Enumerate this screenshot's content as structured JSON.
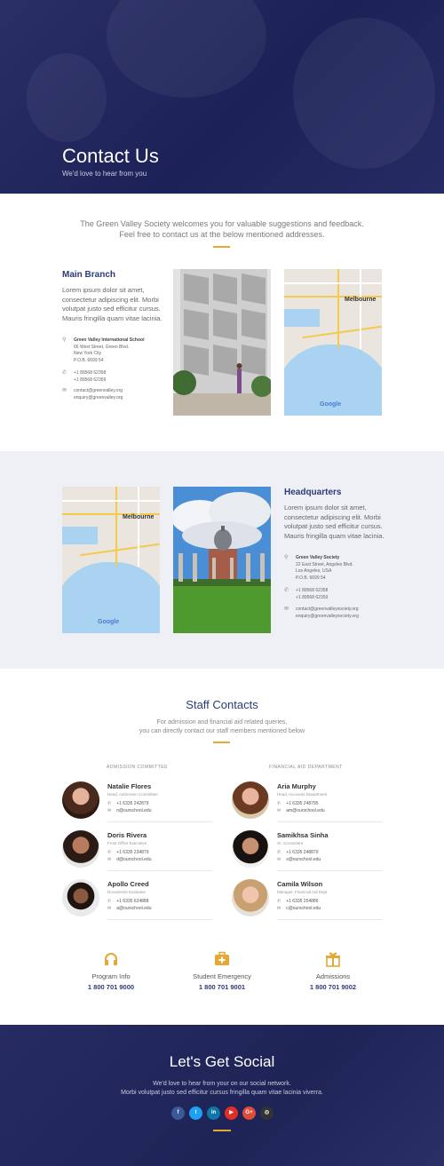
{
  "hero": {
    "title": "Contact Us",
    "subtitle": "We'd love to hear from you"
  },
  "intro": {
    "line1": "The Green Valley Society welcomes you for valuable suggestions and feedback.",
    "line2": "Feel free to contact us at the below mentioned addresses."
  },
  "main_branch": {
    "title": "Main Branch",
    "text": "Lorem ipsum dolor sit amet, consectetur adipiscing elit. Morbi volutpat justo sed efficitur cursus. Mauris fringilla quam vitae lacinia.",
    "address_name": "Green Valley International School",
    "address_lines": [
      "66 West Street, Green Blvd.",
      "New York City",
      "P.O.B. 6699 54"
    ],
    "phones": [
      "+1 89568 62358",
      "+1 89568 62359"
    ],
    "emails": [
      "contact@greenvalley.org",
      "enquiry@greenvalley.org"
    ]
  },
  "headquarters": {
    "title": "Headquarters",
    "text": "Lorem ipsum dolor sit amet, consectetur adipiscing elit. Morbi volutpat justo sed efficitur cursus. Mauris fringilla quam vitae lacinia.",
    "address_name": "Green Valley Society",
    "address_lines": [
      "22 East Street, Angeles Blvd.",
      "Los Angeles, USA",
      "P.O.B. 6699 54"
    ],
    "phones": [
      "+1 89568 62358",
      "+1 89568 62359"
    ],
    "emails": [
      "contact@greenvalleysociety.org",
      "enquiry@greenvalleysociety.org"
    ]
  },
  "map": {
    "city": "Melbourne",
    "logo": "Google"
  },
  "staff": {
    "title": "Staff Contacts",
    "sub1": "For admission and financial aid related queries,",
    "sub2": "you can directly contact our staff members mentioned below",
    "dept_left": "ADMISSION COMMITTEE",
    "dept_right": "FINANCIAL AID DEPARTMENT",
    "left": [
      {
        "name": "Natalie Flores",
        "role": "Head, Admission Committee",
        "phone": "+1 6335 242879",
        "email": "n@ourschool.edu"
      },
      {
        "name": "Doris Rivera",
        "role": "Front Office Executive",
        "phone": "+1 6335 234879",
        "email": "d@ourschool.edu"
      },
      {
        "name": "Apollo Creed",
        "role": "Documents Evaluator",
        "phone": "+1 6335 624888",
        "email": "a@ourschool.edu"
      }
    ],
    "right": [
      {
        "name": "Aria Murphy",
        "role": "Head, Accounts Department",
        "phone": "+1 6335 248795",
        "email": "am@ourschool.edu"
      },
      {
        "name": "Samikhsa Sinha",
        "role": "Sr. Accountant",
        "phone": "+1 6335 248879",
        "email": "s@ourschool.edu"
      },
      {
        "name": "Camila Wilson",
        "role": "Manager, Financial Aid Dept",
        "phone": "+1 6335 254886",
        "email": "c@ourschool.edu"
      }
    ]
  },
  "contact_info": [
    {
      "icon": "headphones-icon",
      "label": "Program Info",
      "number": "1 800 701 9000"
    },
    {
      "icon": "first-aid-kit-icon",
      "label": "Student Emergency",
      "number": "1 800 701 9001"
    },
    {
      "icon": "gift-icon",
      "label": "Admissions",
      "number": "1 800 701 9002"
    }
  ],
  "footer": {
    "title": "Let's Get Social",
    "line1": "We'd love to hear from your on our social network.",
    "line2": "Morbi volutpat justo sed efficitur cursus fringilla quam vitae lacinia viverra.",
    "socials": [
      {
        "icon": "facebook-icon",
        "glyph": "f",
        "color": "#3b5998"
      },
      {
        "icon": "twitter-icon",
        "glyph": "t",
        "color": "#1da1f2"
      },
      {
        "icon": "linkedin-icon",
        "glyph": "in",
        "color": "#0e76a8"
      },
      {
        "icon": "youtube-icon",
        "glyph": "▶",
        "color": "#e52d27"
      },
      {
        "icon": "google-plus-icon",
        "glyph": "G+",
        "color": "#dd4b39"
      },
      {
        "icon": "instagram-icon",
        "glyph": "◎",
        "color": "#333333"
      }
    ]
  },
  "colors": {
    "navy": "#2d3a7a",
    "gold": "#e3a933",
    "hero_bg": "#1c2257"
  }
}
